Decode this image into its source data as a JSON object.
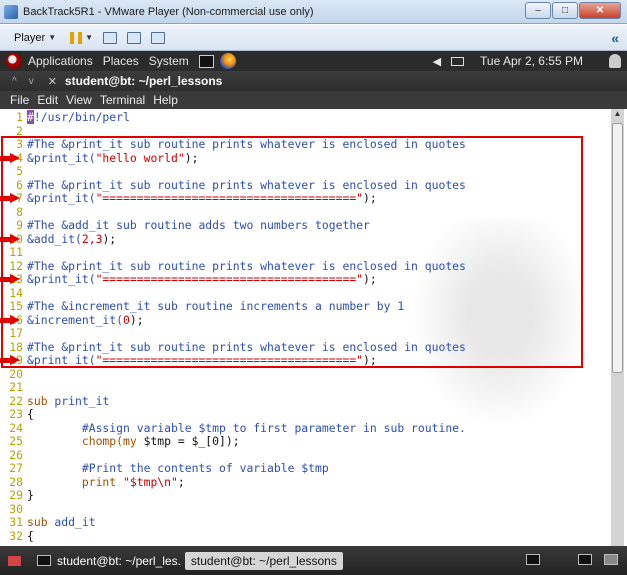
{
  "vm_window": {
    "title": "BackTrack5R1 - VMware Player (Non-commercial use only)",
    "controls": {
      "minimize": "–",
      "maximize": "□",
      "close": "✕"
    }
  },
  "vm_toolbar": {
    "player_label": "Player",
    "collapse": "«"
  },
  "gnome_panel": {
    "menus": [
      "Applications",
      "Places",
      "System"
    ],
    "clock": "Tue Apr  2,  6:55 PM"
  },
  "terminal": {
    "title": "student@bt: ~/perl_lessons",
    "menu": [
      "File",
      "Edit",
      "View",
      "Terminal",
      "Help"
    ]
  },
  "code": {
    "line_numbers": [
      "1",
      "2",
      "3",
      "4",
      "5",
      "6",
      "7",
      "8",
      "9",
      "10",
      "11",
      "12",
      "13",
      "14",
      "15",
      "16",
      "17",
      "18",
      "19",
      "20",
      "21",
      "22",
      "23",
      "24",
      "25",
      "26",
      "27",
      "28",
      "29",
      "30",
      "31",
      "32"
    ],
    "l1a": "#",
    "l1b": "!/usr/bin/perl",
    "comment_print": "#The &print_it sub routine prints whatever is enclosed in quotes",
    "comment_add": "#The &add_it sub routine adds two numbers together",
    "comment_inc": "#The &increment_it sub routine increments a number by 1",
    "call_print": "&print_it(",
    "call_add": "&add_it(",
    "call_inc": "&increment_it(",
    "hello": "\"hello world\"",
    "equals": "\"=====================================\"",
    "add_args": "2,3",
    "inc_arg": "0",
    "close_paren_semi": ");",
    "l19_prefix": "&print it(",
    "sub_kw": "sub",
    "sub_print": " print_it",
    "sub_add": " add_it",
    "brace_open": "{",
    "brace_close": "}",
    "l24": "        #Assign variable $tmp to first parameter in sub routine.",
    "l25a": "        chomp(",
    "l25b": "my",
    "l25c": " $tmp = $_[0]);",
    "l27": "        #Print the contents of variable $tmp",
    "l28a": "        print ",
    "l28b": "\"$tmp\\n\"",
    "l28c": ";"
  },
  "taskbar": {
    "task1": "student@bt: ~/perl_les.",
    "task2": "student@bt: ~/perl_lessons"
  }
}
